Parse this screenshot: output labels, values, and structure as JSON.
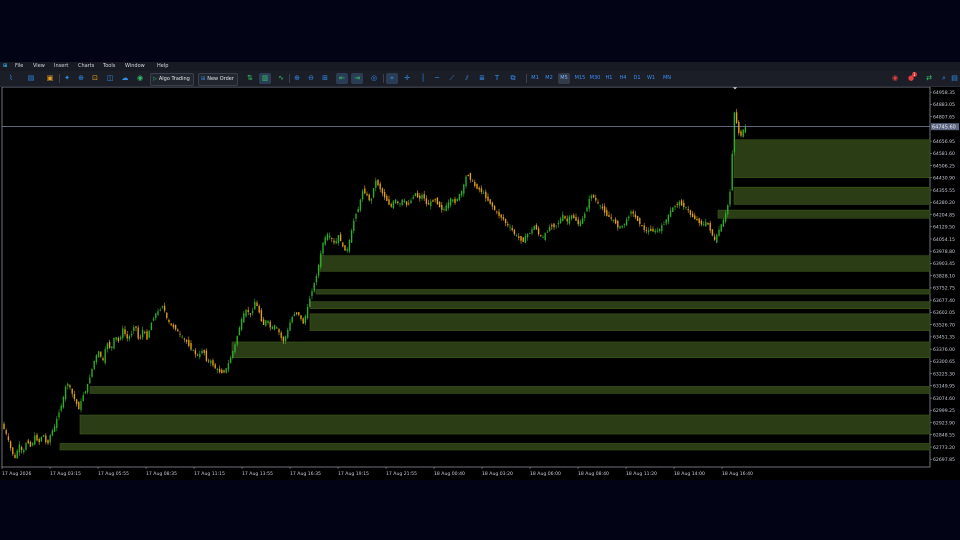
{
  "menu": [
    "File",
    "View",
    "Insert",
    "Charts",
    "Tools",
    "Window",
    "Help"
  ],
  "toolbar": {
    "algo_trading": "Algo Trading",
    "new_order": "New Order",
    "timeframes": [
      "M1",
      "M2",
      "M5",
      "M15",
      "M30",
      "H1",
      "H4",
      "D1",
      "W1",
      "MN"
    ],
    "active_timeframe": "M5",
    "notification_count": "1"
  },
  "colors": {
    "background": "#000000",
    "bull_candle": "#2fae2a",
    "bear_candle": "#e0a017",
    "zone_fill": "#2a3d14",
    "zone_edge": "#3f5a1c",
    "axis_text": "#c8ccd6"
  },
  "chart_data": {
    "type": "candlestick",
    "y_ticks": [
      "64958.35",
      "64883.05",
      "64807.65",
      "64656.95",
      "64581.60",
      "64506.25",
      "64430.90",
      "64355.55",
      "64280.20",
      "64204.85",
      "64129.50",
      "64054.15",
      "63978.80",
      "63903.45",
      "63828.10",
      "63752.75",
      "63677.40",
      "63602.05",
      "63526.70",
      "63451.35",
      "63376.00",
      "63300.65",
      "63225.30",
      "63149.95",
      "63074.60",
      "62999.25",
      "62923.90",
      "62848.55",
      "62773.20",
      "62697.85"
    ],
    "x_ticks": [
      "17 Aug 2026",
      "17 Aug 03:15",
      "17 Aug 05:55",
      "17 Aug 08:35",
      "17 Aug 11:15",
      "17 Aug 13:55",
      "17 Aug 16:35",
      "17 Aug 19:15",
      "17 Aug 21:55",
      "18 Aug 00:40",
      "18 Aug 03:20",
      "18 Aug 06:00",
      "18 Aug 08:40",
      "18 Aug 11:20",
      "18 Aug 14:00",
      "18 Aug 16:40"
    ],
    "ylim": [
      62650,
      64990
    ],
    "current_price": "64745.60",
    "current_price_value": 64745.6,
    "price_path": [
      [
        0,
        62960
      ],
      [
        4,
        62900
      ],
      [
        8,
        62840
      ],
      [
        12,
        62760
      ],
      [
        16,
        62700
      ],
      [
        20,
        62790
      ],
      [
        24,
        62730
      ],
      [
        28,
        62820
      ],
      [
        32,
        62770
      ],
      [
        36,
        62840
      ],
      [
        40,
        62800
      ],
      [
        44,
        62860
      ],
      [
        48,
        62780
      ],
      [
        52,
        62860
      ],
      [
        56,
        62900
      ],
      [
        60,
        62990
      ],
      [
        64,
        63060
      ],
      [
        68,
        63180
      ],
      [
        72,
        63120
      ],
      [
        76,
        63060
      ],
      [
        80,
        63010
      ],
      [
        84,
        63090
      ],
      [
        88,
        63140
      ],
      [
        92,
        63230
      ],
      [
        96,
        63320
      ],
      [
        100,
        63360
      ],
      [
        104,
        63300
      ],
      [
        108,
        63420
      ],
      [
        112,
        63370
      ],
      [
        116,
        63460
      ],
      [
        120,
        63420
      ],
      [
        124,
        63500
      ],
      [
        128,
        63440
      ],
      [
        132,
        63460
      ],
      [
        136,
        63540
      ],
      [
        140,
        63420
      ],
      [
        144,
        63500
      ],
      [
        148,
        63440
      ],
      [
        152,
        63530
      ],
      [
        156,
        63590
      ],
      [
        160,
        63610
      ],
      [
        164,
        63650
      ],
      [
        168,
        63560
      ],
      [
        172,
        63520
      ],
      [
        176,
        63510
      ],
      [
        180,
        63470
      ],
      [
        184,
        63440
      ],
      [
        188,
        63420
      ],
      [
        192,
        63380
      ],
      [
        196,
        63350
      ],
      [
        200,
        63330
      ],
      [
        204,
        63380
      ],
      [
        208,
        63300
      ],
      [
        212,
        63300
      ],
      [
        216,
        63260
      ],
      [
        220,
        63240
      ],
      [
        224,
        63230
      ],
      [
        228,
        63260
      ],
      [
        232,
        63330
      ],
      [
        236,
        63400
      ],
      [
        240,
        63500
      ],
      [
        244,
        63580
      ],
      [
        248,
        63620
      ],
      [
        252,
        63580
      ],
      [
        256,
        63670
      ],
      [
        260,
        63610
      ],
      [
        264,
        63520
      ],
      [
        268,
        63560
      ],
      [
        272,
        63500
      ],
      [
        276,
        63520
      ],
      [
        280,
        63480
      ],
      [
        284,
        63420
      ],
      [
        288,
        63470
      ],
      [
        292,
        63560
      ],
      [
        296,
        63600
      ],
      [
        300,
        63590
      ],
      [
        304,
        63530
      ],
      [
        308,
        63610
      ],
      [
        312,
        63720
      ],
      [
        316,
        63790
      ],
      [
        320,
        63900
      ],
      [
        324,
        64030
      ],
      [
        328,
        64080
      ],
      [
        332,
        64060
      ],
      [
        336,
        64020
      ],
      [
        340,
        64080
      ],
      [
        344,
        64000
      ],
      [
        348,
        63980
      ],
      [
        352,
        64080
      ],
      [
        356,
        64200
      ],
      [
        360,
        64250
      ],
      [
        364,
        64360
      ],
      [
        368,
        64320
      ],
      [
        372,
        64280
      ],
      [
        376,
        64420
      ],
      [
        380,
        64380
      ],
      [
        384,
        64330
      ],
      [
        388,
        64290
      ],
      [
        392,
        64250
      ],
      [
        396,
        64300
      ],
      [
        400,
        64260
      ],
      [
        404,
        64300
      ],
      [
        408,
        64260
      ],
      [
        412,
        64290
      ],
      [
        416,
        64340
      ],
      [
        420,
        64300
      ],
      [
        424,
        64330
      ],
      [
        428,
        64260
      ],
      [
        432,
        64280
      ],
      [
        436,
        64300
      ],
      [
        440,
        64260
      ],
      [
        444,
        64230
      ],
      [
        448,
        64260
      ],
      [
        452,
        64300
      ],
      [
        456,
        64280
      ],
      [
        460,
        64320
      ],
      [
        464,
        64360
      ],
      [
        468,
        64460
      ],
      [
        472,
        64420
      ],
      [
        476,
        64380
      ],
      [
        480,
        64360
      ],
      [
        484,
        64340
      ],
      [
        488,
        64300
      ],
      [
        492,
        64270
      ],
      [
        496,
        64230
      ],
      [
        500,
        64200
      ],
      [
        504,
        64180
      ],
      [
        508,
        64140
      ],
      [
        512,
        64120
      ],
      [
        516,
        64080
      ],
      [
        520,
        64060
      ],
      [
        524,
        64040
      ],
      [
        528,
        64080
      ],
      [
        532,
        64100
      ],
      [
        536,
        64140
      ],
      [
        540,
        64080
      ],
      [
        544,
        64060
      ],
      [
        548,
        64100
      ],
      [
        552,
        64140
      ],
      [
        556,
        64130
      ],
      [
        560,
        64160
      ],
      [
        564,
        64200
      ],
      [
        568,
        64160
      ],
      [
        572,
        64200
      ],
      [
        576,
        64180
      ],
      [
        580,
        64140
      ],
      [
        584,
        64180
      ],
      [
        588,
        64250
      ],
      [
        592,
        64330
      ],
      [
        596,
        64300
      ],
      [
        600,
        64260
      ],
      [
        604,
        64240
      ],
      [
        608,
        64200
      ],
      [
        612,
        64180
      ],
      [
        616,
        64160
      ],
      [
        620,
        64120
      ],
      [
        624,
        64140
      ],
      [
        628,
        64170
      ],
      [
        632,
        64230
      ],
      [
        636,
        64190
      ],
      [
        640,
        64160
      ],
      [
        644,
        64120
      ],
      [
        648,
        64100
      ],
      [
        652,
        64110
      ],
      [
        656,
        64100
      ],
      [
        660,
        64110
      ],
      [
        664,
        64140
      ],
      [
        668,
        64180
      ],
      [
        672,
        64230
      ],
      [
        676,
        64260
      ],
      [
        680,
        64280
      ],
      [
        684,
        64260
      ],
      [
        688,
        64240
      ],
      [
        692,
        64200
      ],
      [
        696,
        64180
      ],
      [
        700,
        64160
      ],
      [
        704,
        64140
      ],
      [
        708,
        64160
      ],
      [
        712,
        64100
      ],
      [
        716,
        64040
      ],
      [
        720,
        64110
      ],
      [
        724,
        64160
      ],
      [
        728,
        64230
      ],
      [
        732,
        64380
      ],
      [
        735,
        64850
      ],
      [
        738,
        64760
      ],
      [
        741,
        64680
      ],
      [
        744,
        64720
      ],
      [
        747,
        64740
      ]
    ],
    "zones": [
      [
        64665,
        64432
      ],
      [
        64373,
        64267
      ],
      [
        64232,
        64182
      ],
      [
        63951,
        63855
      ],
      [
        63743,
        63715
      ],
      [
        63668,
        63625
      ],
      [
        63593,
        63490
      ],
      [
        63420,
        63323
      ],
      [
        63146,
        63103
      ],
      [
        62970,
        62853
      ],
      [
        62795,
        62755
      ]
    ]
  }
}
